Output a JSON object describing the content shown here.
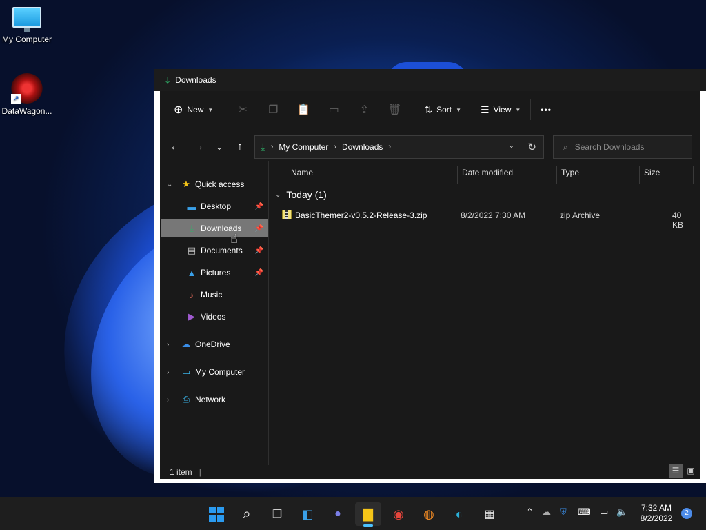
{
  "desktop": {
    "icons": [
      {
        "label": "My Computer",
        "icon": "monitor-icon"
      },
      {
        "label": "DataWagon...",
        "icon": "datawagon-app-icon"
      }
    ]
  },
  "window": {
    "title": "Downloads",
    "toolbar": {
      "new_label": "New",
      "sort_label": "Sort",
      "view_label": "View",
      "more_label": "•••"
    },
    "address": {
      "segments": [
        "My Computer",
        "Downloads"
      ],
      "search_placeholder": "Search Downloads"
    },
    "nav": {
      "quick_access": "Quick access",
      "items": [
        {
          "label": "Desktop",
          "pinned": true,
          "icon": "desktop-folder-icon"
        },
        {
          "label": "Downloads",
          "pinned": true,
          "icon": "download-icon",
          "selected": true
        },
        {
          "label": "Documents",
          "pinned": true,
          "icon": "documents-icon"
        },
        {
          "label": "Pictures",
          "pinned": true,
          "icon": "pictures-icon"
        },
        {
          "label": "Music",
          "pinned": false,
          "icon": "music-icon"
        },
        {
          "label": "Videos",
          "pinned": false,
          "icon": "videos-icon"
        }
      ],
      "roots": [
        {
          "label": "OneDrive",
          "icon": "cloud-icon"
        },
        {
          "label": "My Computer",
          "icon": "monitor-icon"
        },
        {
          "label": "Network",
          "icon": "network-icon"
        }
      ]
    },
    "columns": {
      "name": "Name",
      "date": "Date modified",
      "type": "Type",
      "size": "Size"
    },
    "group_label": "Today (1)",
    "files": [
      {
        "name": "BasicThemer2-v0.5.2-Release-3.zip",
        "date": "8/2/2022 7:30 AM",
        "type": "zip Archive",
        "size": "40 KB"
      }
    ],
    "status": "1 item"
  },
  "taskbar": {
    "time": "7:32 AM",
    "date": "8/2/2022",
    "notifications": "2"
  },
  "colors": {
    "window_bg": "#191919",
    "titlebar_bg": "#1c1c1c",
    "selection": "#777777",
    "accent": "#4cc2ff",
    "download_green": "#2fb36a"
  }
}
